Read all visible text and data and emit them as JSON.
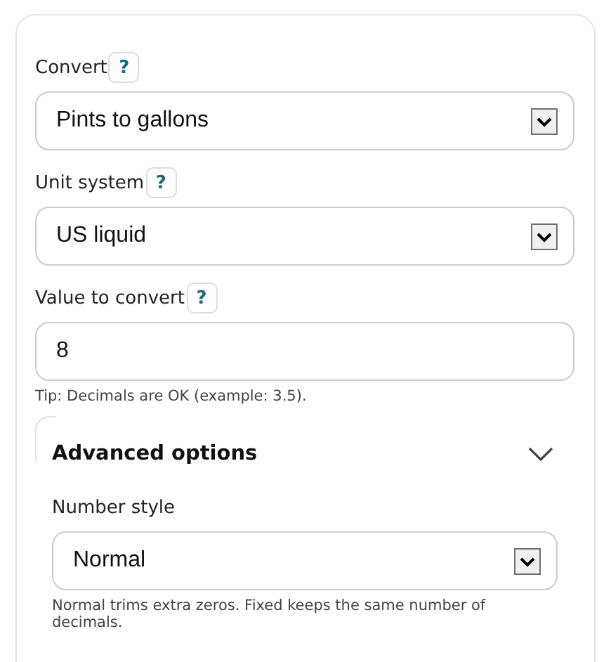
{
  "fields": [
    {
      "kind": "select",
      "label": "Convert",
      "help": "?",
      "value": "Pints to gallons"
    },
    {
      "kind": "select",
      "label": "Unit system",
      "help": "?",
      "value": "US liquid"
    },
    {
      "kind": "input",
      "label": "Value to convert",
      "help": "?",
      "value": "8",
      "tip": "Tip: Decimals are OK (example: 3.5)."
    }
  ],
  "advanced": {
    "title": "Advanced options",
    "expanded": true,
    "fields": [
      {
        "kind": "select",
        "label": "Number style",
        "value": "Normal",
        "tip": "Normal trims extra zeros. Fixed keeps the same number of decimals."
      }
    ]
  }
}
